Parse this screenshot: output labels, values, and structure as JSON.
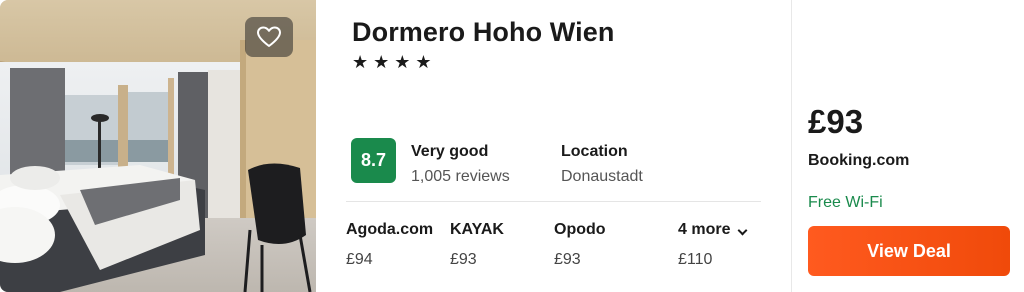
{
  "hotel": {
    "name": "Dormero Hoho Wien",
    "stars": "★★★★"
  },
  "rating": {
    "score": "8.7",
    "label": "Very good",
    "reviews": "1,005 reviews"
  },
  "location": {
    "label": "Location",
    "value": "Donaustadt"
  },
  "providers": [
    {
      "name": "Agoda.com",
      "price": "£94"
    },
    {
      "name": "KAYAK",
      "price": "£93"
    },
    {
      "name": "Opodo",
      "price": "£93"
    }
  ],
  "more": {
    "label": "4 more",
    "price": "£110"
  },
  "deal": {
    "price": "£93",
    "site": "Booking.com",
    "amenity": "Free Wi-Fi",
    "button_label": "View Deal"
  },
  "icons": {
    "favorite": "heart-icon",
    "expand": "chevron-down-icon"
  },
  "colors": {
    "rating_badge": "#1a8a4c",
    "amenity_text": "#1a8a4c",
    "deal_button": "#ff5a1f"
  }
}
